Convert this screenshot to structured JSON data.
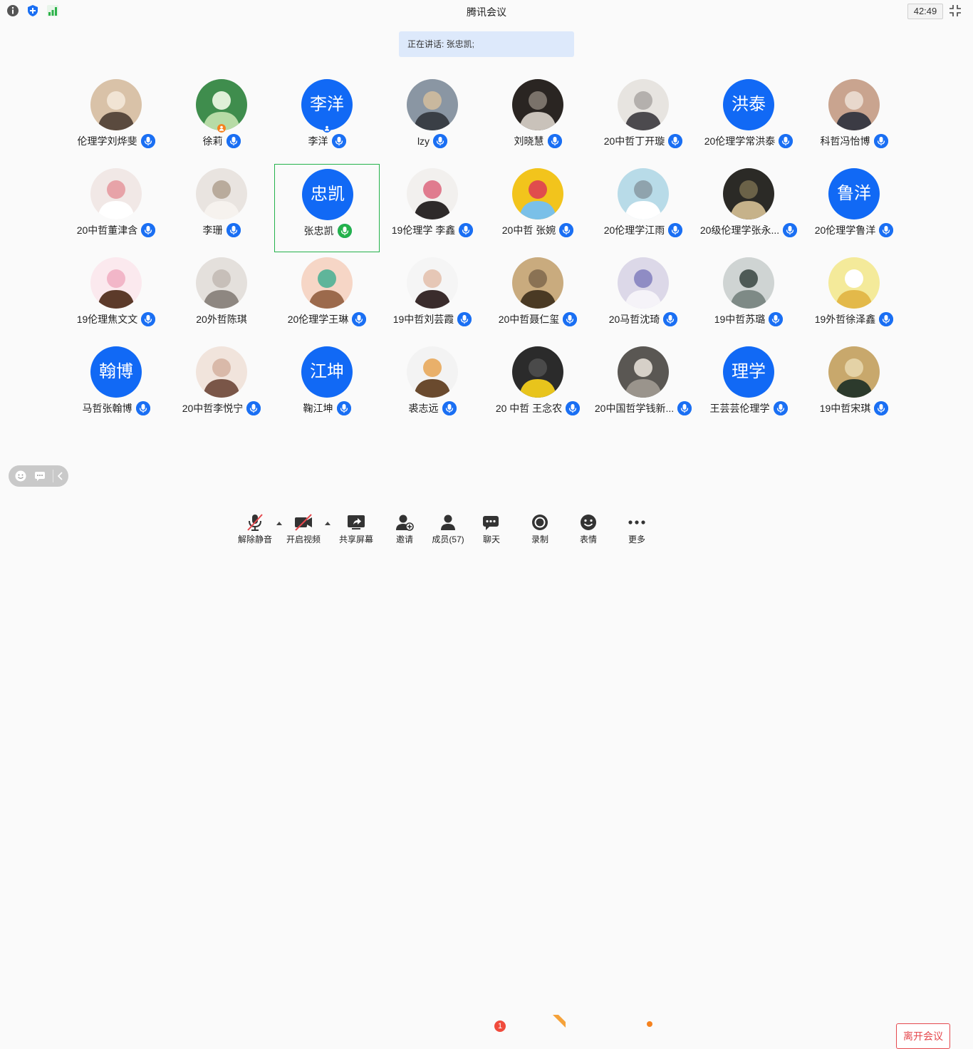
{
  "window": {
    "title": "腾讯会议",
    "timer": "42:49",
    "icons": [
      "info-icon",
      "shield-icon",
      "signal-icon",
      "fullscreen-icon"
    ]
  },
  "speaking": {
    "text": "正在讲话: 张忠凯;"
  },
  "colors": {
    "accent": "#1169f5",
    "active_border": "#24b24b",
    "leave_red": "#e5484d",
    "badge_orange": "#f5821f",
    "notif_red": "#f04b3c"
  },
  "participants": [
    {
      "name": "伦理学刘烨斐",
      "avatar": "photo"
    },
    {
      "name": "徐莉",
      "avatar": "photo",
      "badge": "host"
    },
    {
      "name": "李洋",
      "avatar_text": "李洋",
      "badge": "cohost"
    },
    {
      "name": "lzy",
      "avatar": "photo"
    },
    {
      "name": "刘晓慧",
      "avatar": "photo"
    },
    {
      "name": "20中哲丁开璇",
      "avatar": "photo"
    },
    {
      "name": "20伦理学常洪泰",
      "avatar_text": "洪泰"
    },
    {
      "name": "科哲冯怡博",
      "avatar": "photo"
    },
    {
      "name": "20中哲董津含",
      "avatar": "photo"
    },
    {
      "name": "李珊",
      "avatar": "photo"
    },
    {
      "name": "张忠凯",
      "avatar_text": "忠凯",
      "speaking": true
    },
    {
      "name": "19伦理学 李鑫",
      "avatar": "photo"
    },
    {
      "name": "20中哲 张婉",
      "avatar": "photo"
    },
    {
      "name": "20伦理学江雨",
      "avatar": "photo"
    },
    {
      "name": "20级伦理学张永...",
      "avatar": "photo"
    },
    {
      "name": "20伦理学鲁洋",
      "avatar_text": "鲁洋"
    },
    {
      "name": "19伦理焦文文",
      "avatar": "photo"
    },
    {
      "name": "20外哲陈琪",
      "avatar": "photo",
      "mic_visible": false
    },
    {
      "name": "20伦理学王琳",
      "avatar": "photo"
    },
    {
      "name": "19中哲刘芸霞",
      "avatar": "photo"
    },
    {
      "name": "20中哲聂仁玺",
      "avatar": "photo"
    },
    {
      "name": "20马哲沈琦",
      "avatar": "photo"
    },
    {
      "name": "19中哲苏璐",
      "avatar": "photo"
    },
    {
      "name": "19外哲徐泽鑫",
      "avatar": "photo"
    },
    {
      "name": "马哲张翰博",
      "avatar_text": "翰博"
    },
    {
      "name": "20中哲李悦宁",
      "avatar": "photo"
    },
    {
      "name": "鞠江坤",
      "avatar_text": "江坤"
    },
    {
      "name": "裘志远",
      "avatar": "photo"
    },
    {
      "name": "20 中哲 王念农",
      "avatar": "photo"
    },
    {
      "name": "20中国哲学钱新...",
      "avatar": "photo"
    },
    {
      "name": "王芸芸伦理学",
      "avatar_text": "理学"
    },
    {
      "name": "19中哲宋琪",
      "avatar": "photo"
    }
  ],
  "toolbar": {
    "unmute": "解除静音",
    "video": "开启视频",
    "share": "共享屏幕",
    "invite": "邀请",
    "members": "成员(57)",
    "chat": "聊天",
    "chat_badge": "1",
    "record": "录制",
    "reactions": "表情",
    "more": "更多",
    "leave": "离开会议"
  }
}
